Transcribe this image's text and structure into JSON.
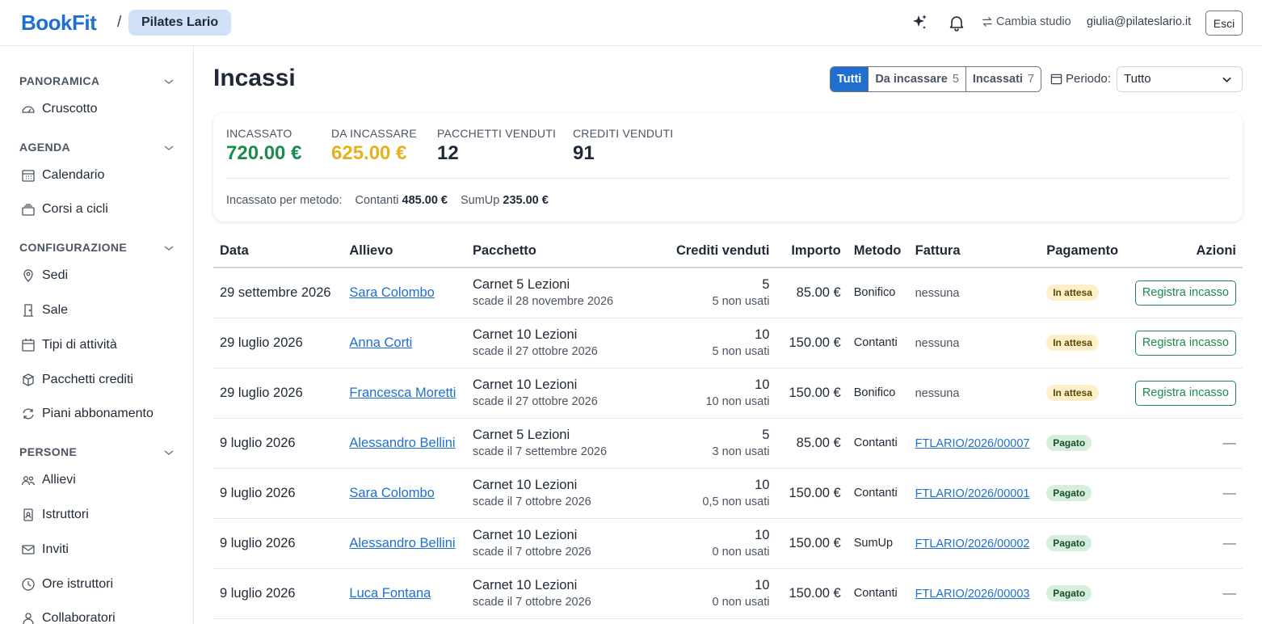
{
  "topbar": {
    "logo": "BookFit",
    "separator": "/",
    "studio": "Pilates Lario",
    "switch_studio": "Cambia studio",
    "user_email": "giulia@pilateslario.it",
    "logout": "Esci"
  },
  "sidebar": {
    "sections": [
      {
        "title": "PANORAMICA",
        "items": [
          {
            "label": "Cruscotto",
            "icon": "gauge-icon"
          }
        ]
      },
      {
        "title": "AGENDA",
        "items": [
          {
            "label": "Calendario",
            "icon": "calendar-icon"
          },
          {
            "label": "Corsi a cicli",
            "icon": "stack-icon"
          }
        ]
      },
      {
        "title": "CONFIGURAZIONE",
        "items": [
          {
            "label": "Sedi",
            "icon": "map-pin-icon"
          },
          {
            "label": "Sale",
            "icon": "door-icon"
          },
          {
            "label": "Tipi di attività",
            "icon": "calendar-icon"
          },
          {
            "label": "Pacchetti crediti",
            "icon": "package-icon"
          },
          {
            "label": "Piani abbonamento",
            "icon": "refresh-icon"
          }
        ]
      },
      {
        "title": "PERSONE",
        "items": [
          {
            "label": "Allievi",
            "icon": "users-icon"
          },
          {
            "label": "Istruttori",
            "icon": "id-badge-icon"
          },
          {
            "label": "Inviti",
            "icon": "mail-icon"
          },
          {
            "label": "Ore istruttori",
            "icon": "clock-icon"
          },
          {
            "label": "Collaboratori",
            "icon": "user-icon"
          }
        ]
      }
    ]
  },
  "main": {
    "title": "Incassi",
    "filters": [
      {
        "label": "Tutti",
        "count": "",
        "active": true
      },
      {
        "label": "Da incassare",
        "count": "5",
        "active": false
      },
      {
        "label": "Incassati",
        "count": "7",
        "active": false
      }
    ],
    "period_label": "Periodo:",
    "period_value": "Tutto"
  },
  "stats": {
    "collected": {
      "label": "INCASSATO",
      "value": "720.00 €",
      "color": "#1d8a4e"
    },
    "to_collect": {
      "label": "DA INCASSARE",
      "value": "625.00 €",
      "color": "#e8b01f"
    },
    "packages_sold": {
      "label": "PACCHETTI VENDUTI",
      "value": "12"
    },
    "credits_sold": {
      "label": "CREDITI VENDUTI",
      "value": "91"
    },
    "methods_label": "Incassato per metodo:",
    "methods": [
      {
        "name": "Contanti",
        "amount": "485.00 €"
      },
      {
        "name": "SumUp",
        "amount": "235.00 €"
      }
    ]
  },
  "table": {
    "headers": {
      "date": "Data",
      "student": "Allievo",
      "package": "Pacchetto",
      "credits": "Crediti venduti",
      "amount": "Importo",
      "method": "Metodo",
      "invoice": "Fattura",
      "payment": "Pagamento",
      "actions": "Azioni"
    },
    "register_label": "Registra incasso",
    "rows": [
      {
        "date": "29 settembre 2026",
        "student": "Sara Colombo",
        "package": "Carnet 5 Lezioni",
        "expiry": "scade il 28 novembre 2026",
        "credits": "5",
        "unused": "5 non usati",
        "amount": "85.00 €",
        "method": "Bonifico",
        "invoice": "nessuna",
        "status": "In attesa",
        "action": "Registra incasso"
      },
      {
        "date": "29 luglio 2026",
        "student": "Anna Corti",
        "package": "Carnet 10 Lezioni",
        "expiry": "scade il 27 ottobre 2026",
        "credits": "10",
        "unused": "5 non usati",
        "amount": "150.00 €",
        "method": "Contanti",
        "invoice": "nessuna",
        "status": "In attesa",
        "action": "Registra incasso"
      },
      {
        "date": "29 luglio 2026",
        "student": "Francesca Moretti",
        "package": "Carnet 10 Lezioni",
        "expiry": "scade il 27 ottobre 2026",
        "credits": "10",
        "unused": "10 non usati",
        "amount": "150.00 €",
        "method": "Bonifico",
        "invoice": "nessuna",
        "status": "In attesa",
        "action": "Registra incasso"
      },
      {
        "date": "9 luglio 2026",
        "student": "Alessandro Bellini",
        "package": "Carnet 5 Lezioni",
        "expiry": "scade il 7 settembre 2026",
        "credits": "5",
        "unused": "3 non usati",
        "amount": "85.00 €",
        "method": "Contanti",
        "invoice": "FTLARIO/2026/00007",
        "status": "Pagato",
        "action": "—"
      },
      {
        "date": "9 luglio 2026",
        "student": "Sara Colombo",
        "package": "Carnet 10 Lezioni",
        "expiry": "scade il 7 ottobre 2026",
        "credits": "10",
        "unused": "0,5 non usati",
        "amount": "150.00 €",
        "method": "Contanti",
        "invoice": "FTLARIO/2026/00001",
        "status": "Pagato",
        "action": "—"
      },
      {
        "date": "9 luglio 2026",
        "student": "Alessandro Bellini",
        "package": "Carnet 10 Lezioni",
        "expiry": "scade il 7 ottobre 2026",
        "credits": "10",
        "unused": "0 non usati",
        "amount": "150.00 €",
        "method": "SumUp",
        "invoice": "FTLARIO/2026/00002",
        "status": "Pagato",
        "action": "—"
      },
      {
        "date": "9 luglio 2026",
        "student": "Luca Fontana",
        "package": "Carnet 10 Lezioni",
        "expiry": "scade il 7 ottobre 2026",
        "credits": "10",
        "unused": "0 non usati",
        "amount": "150.00 €",
        "method": "Contanti",
        "invoice": "FTLARIO/2026/00003",
        "status": "Pagato",
        "action": "—"
      }
    ]
  }
}
